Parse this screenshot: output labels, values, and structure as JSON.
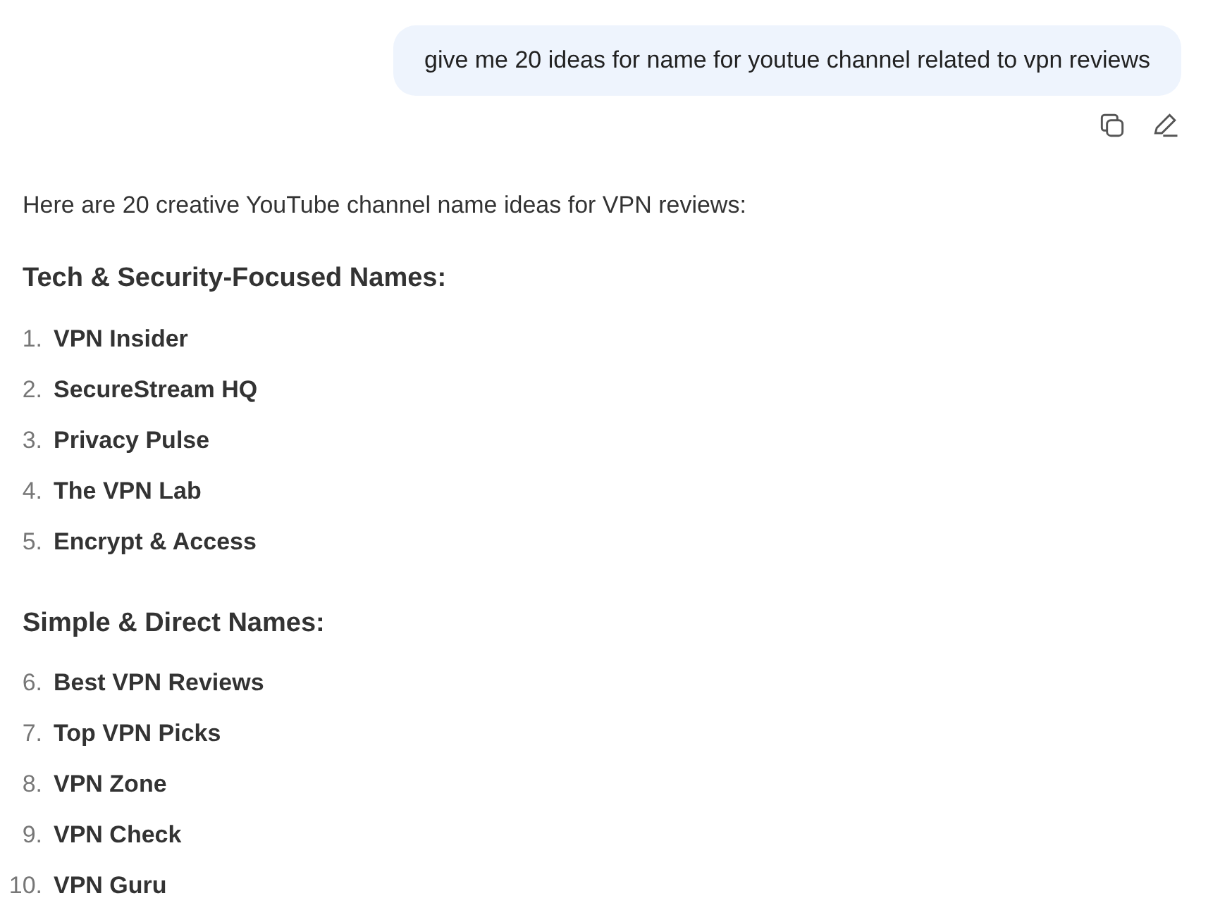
{
  "user_message": {
    "text": "give me 20 ideas for name for youtue channel related to vpn reviews"
  },
  "reply": {
    "intro": "Here are 20 creative YouTube channel name ideas for VPN reviews:",
    "sections": [
      {
        "heading": "Tech & Security-Focused Names:",
        "items": [
          {
            "number": "1.",
            "text": "VPN Insider"
          },
          {
            "number": "2.",
            "text": "SecureStream HQ"
          },
          {
            "number": "3.",
            "text": "Privacy Pulse"
          },
          {
            "number": "4.",
            "text": "The VPN Lab"
          },
          {
            "number": "5.",
            "text": "Encrypt & Access"
          }
        ]
      },
      {
        "heading": "Simple & Direct Names:",
        "items": [
          {
            "number": "6.",
            "text": "Best VPN Reviews"
          },
          {
            "number": "7.",
            "text": "Top VPN Picks"
          },
          {
            "number": "8.",
            "text": "VPN Zone"
          },
          {
            "number": "9.",
            "text": "VPN Check"
          },
          {
            "number": "10.",
            "text": "VPN Guru"
          }
        ]
      }
    ]
  }
}
